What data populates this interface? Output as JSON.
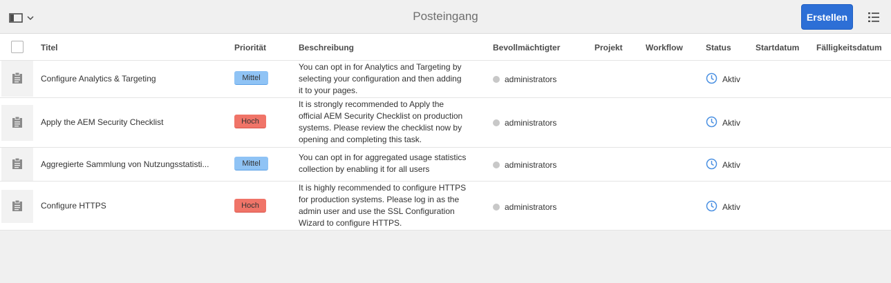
{
  "header": {
    "title": "Posteingang",
    "create_label": "Erstellen"
  },
  "columns": {
    "title": "Titel",
    "priority": "Priorität",
    "description": "Beschreibung",
    "assignee": "Bevollmächtigter",
    "project": "Projekt",
    "workflow": "Workflow",
    "status": "Status",
    "start_date": "Startdatum",
    "due_date": "Fälligkeitsdatum"
  },
  "rows": [
    {
      "title": "Configure Analytics & Targeting",
      "priority": "Mittel",
      "priority_level": "medium",
      "description_lines": [
        "You can opt in for Analytics and Targeting by",
        "selecting your configuration and then adding",
        "it to your pages."
      ],
      "assignee": "administrators",
      "status": "Aktiv"
    },
    {
      "title": "Apply the AEM Security Checklist",
      "priority": "Hoch",
      "priority_level": "high",
      "description_lines": [
        "It is strongly recommended to Apply the",
        "official AEM Security Checklist on production",
        "systems. Please review the checklist now by",
        "opening and completing this task."
      ],
      "assignee": "administrators",
      "status": "Aktiv"
    },
    {
      "title": "Aggregierte Sammlung von Nutzungsstatisti...",
      "priority": "Mittel",
      "priority_level": "medium",
      "description_lines": [
        "You can opt in for aggregated usage statistics",
        "collection by enabling it for all users"
      ],
      "assignee": "administrators",
      "status": "Aktiv"
    },
    {
      "title": "Configure HTTPS",
      "priority": "Hoch",
      "priority_level": "high",
      "description_lines": [
        "It is highly recommended to configure HTTPS",
        "for production systems. Please log in as the",
        "admin user and use the SSL Configuration",
        "Wizard to configure HTTPS."
      ],
      "assignee": "administrators",
      "status": "Aktiv"
    }
  ],
  "colors": {
    "accent": "#2d6fd6",
    "priority_medium": "#8fc3f5",
    "priority_high": "#f07468",
    "status_icon": "#4a90e2"
  },
  "icons": {
    "rail_toggle": "sidebar-panel-icon",
    "view_switch": "list-view-icon",
    "task": "clipboard-icon",
    "status": "clock-icon",
    "assignee": "avatar"
  }
}
